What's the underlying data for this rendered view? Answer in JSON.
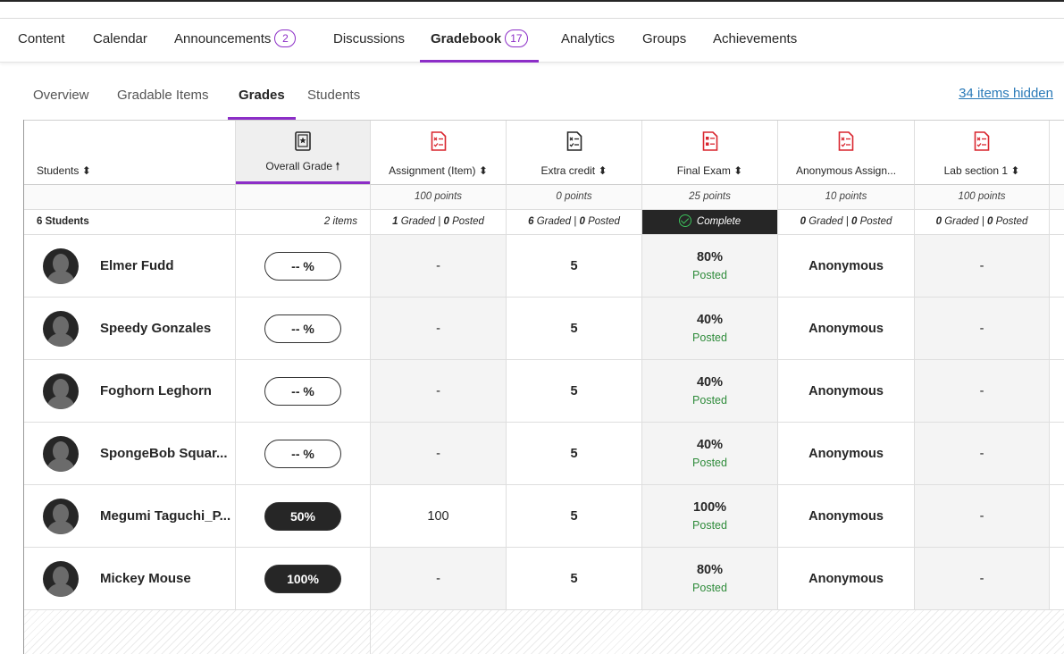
{
  "nav": {
    "tabs": [
      {
        "label": "Content"
      },
      {
        "label": "Calendar"
      },
      {
        "label": "Announcements",
        "badge": "2"
      },
      {
        "label": "Discussions"
      },
      {
        "label": "Gradebook",
        "badge": "17"
      },
      {
        "label": "Analytics"
      },
      {
        "label": "Groups"
      },
      {
        "label": "Achievements"
      }
    ],
    "active": "Gradebook"
  },
  "subnav": {
    "tabs": [
      "Overview",
      "Gradable Items",
      "Grades",
      "Students"
    ],
    "active": "Grades",
    "hidden_link": "34 items hidden"
  },
  "table": {
    "headers": [
      {
        "label": "Students ⬍"
      },
      {
        "label": "Overall Grade 🠕",
        "icon": "overall-grade-icon"
      },
      {
        "label": "Assignment (Item) ⬍",
        "icon": "assignment-icon"
      },
      {
        "label": "Extra credit ⬍",
        "icon": "assignment-icon"
      },
      {
        "label": "Final Exam ⬍",
        "icon": "exam-icon"
      },
      {
        "label": "Anonymous Assign...",
        "icon": "assignment-icon"
      },
      {
        "label": "Lab section 1 ⬍",
        "icon": "assignment-icon"
      }
    ],
    "points": [
      "",
      "",
      "100 points",
      "0 points",
      "25 points",
      "10 points",
      "100 points"
    ],
    "summary": {
      "students": "6 Students",
      "overall": "2 items",
      "assignment": {
        "graded": "1",
        "graded_label": "Graded",
        "posted": "0",
        "posted_label": "Posted"
      },
      "extra_credit": {
        "graded": "6",
        "graded_label": "Graded",
        "posted": "0",
        "posted_label": "Posted"
      },
      "final_exam": "Complete",
      "anonymous": {
        "graded": "0",
        "graded_label": "Graded",
        "posted": "0",
        "posted_label": "Posted"
      },
      "lab": {
        "graded": "0",
        "graded_label": "Graded",
        "posted": "0",
        "posted_label": "Posted"
      }
    },
    "rows": [
      {
        "name": "Elmer Fudd",
        "overall": "-- %",
        "overall_filled": false,
        "assignment": "-",
        "extra": "5",
        "final": "80%",
        "final_status": "Posted",
        "anon": "Anonymous",
        "lab": "-"
      },
      {
        "name": "Speedy Gonzales",
        "overall": "-- %",
        "overall_filled": false,
        "assignment": "-",
        "extra": "5",
        "final": "40%",
        "final_status": "Posted",
        "anon": "Anonymous",
        "lab": "-"
      },
      {
        "name": "Foghorn Leghorn",
        "overall": "-- %",
        "overall_filled": false,
        "assignment": "-",
        "extra": "5",
        "final": "40%",
        "final_status": "Posted",
        "anon": "Anonymous",
        "lab": "-"
      },
      {
        "name": "SpongeBob Squar...",
        "overall": "-- %",
        "overall_filled": false,
        "assignment": "-",
        "extra": "5",
        "final": "40%",
        "final_status": "Posted",
        "anon": "Anonymous",
        "lab": "-"
      },
      {
        "name": "Megumi Taguchi_P...",
        "overall": "50%",
        "overall_filled": true,
        "assignment": "100",
        "extra": "5",
        "final": "100%",
        "final_status": "Posted",
        "anon": "Anonymous",
        "lab": "-"
      },
      {
        "name": "Mickey Mouse",
        "overall": "100%",
        "overall_filled": true,
        "assignment": "-",
        "extra": "5",
        "final": "80%",
        "final_status": "Posted",
        "anon": "Anonymous",
        "lab": "-"
      }
    ]
  },
  "colors": {
    "accent": "#8c2ec7",
    "link": "#2a7ab8",
    "posted": "#2e8b3a",
    "icon_red": "#d9262f"
  }
}
